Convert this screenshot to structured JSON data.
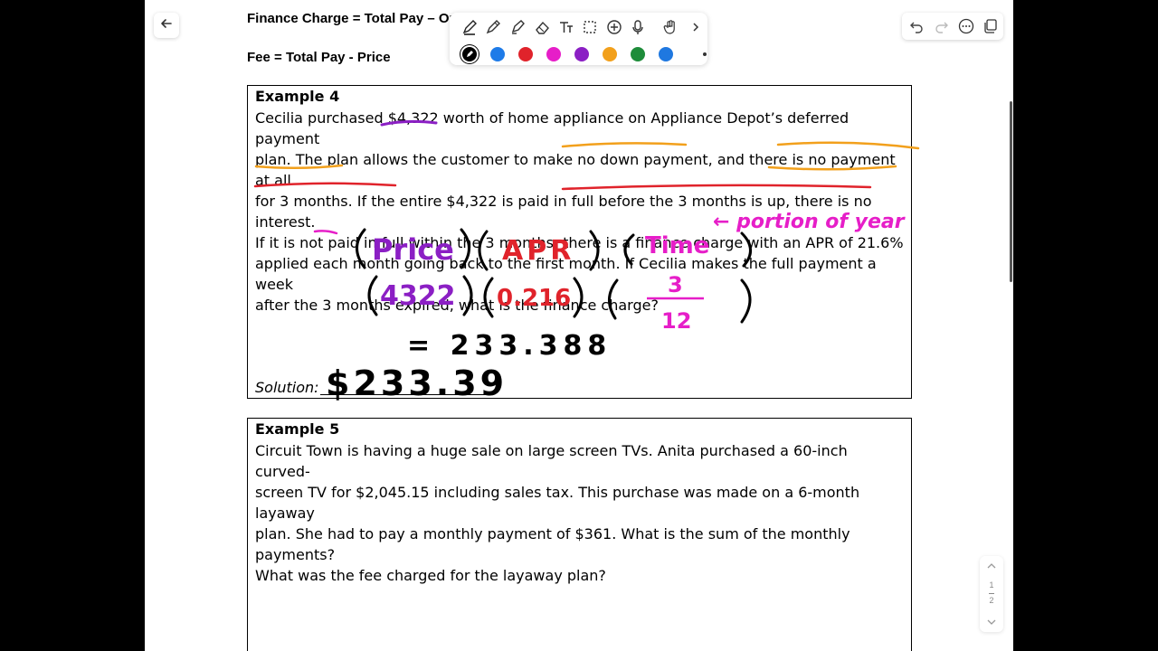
{
  "formulas": {
    "finance_charge": "Finance Charge = Total Pay – Or",
    "fee": "Fee = Total Pay - Price"
  },
  "toolbar": {
    "tools": [
      "pen-icon",
      "pencil-icon",
      "highlighter-icon",
      "eraser-icon",
      "text-icon",
      "lasso-icon",
      "add-icon",
      "microphone-icon",
      "hand-gesture-icon",
      "chevron-right-icon"
    ],
    "colors": [
      "#000000",
      "#1e7be8",
      "#e0232b",
      "#e61ec8",
      "#8b1fc4",
      "#f2a01c",
      "#1e8c3a",
      "#1f78e0"
    ]
  },
  "right_tools": [
    "undo-icon",
    "redo-icon",
    "more-icon",
    "pages-icon"
  ],
  "example4": {
    "title": "Example 4",
    "lines": [
      "Cecilia purchased $4,322 worth of home appliance on Appliance Depot’s deferred payment",
      "plan. The plan allows the customer to make no down payment, and there is no payment at all",
      "for 3 months. If the entire $4,322 is paid in full before the 3 months is up, there is no interest.",
      "If it is not paid in full within the 3 months, there is a finance charge with an APR of 21.6%",
      "applied each month going back to the first month. If Cecilia makes the full payment a week",
      "after the 3 months expired, what is the finance charge?"
    ],
    "solution_label": "Solution:"
  },
  "handwriting": {
    "price": "Price",
    "apr": "APR",
    "time": "Time",
    "note": "← portion of year",
    "price_val": "4322",
    "apr_val": "0.216",
    "num": "3",
    "den": "12",
    "result": "= 233.388",
    "solution": "$233.39"
  },
  "example5": {
    "title": "Example 5",
    "lines": [
      "Circuit Town is having a huge sale on large screen TVs. Anita purchased a 60-inch curved-",
      "screen TV for $2,045.15 including sales tax. This purchase was made on a 6-month layaway",
      "plan. She had to pay a monthly payment of $361. What is the sum of the monthly payments?",
      "What was the fee charged for the layaway plan?"
    ]
  },
  "pager": {
    "current": "1",
    "total": "2"
  }
}
